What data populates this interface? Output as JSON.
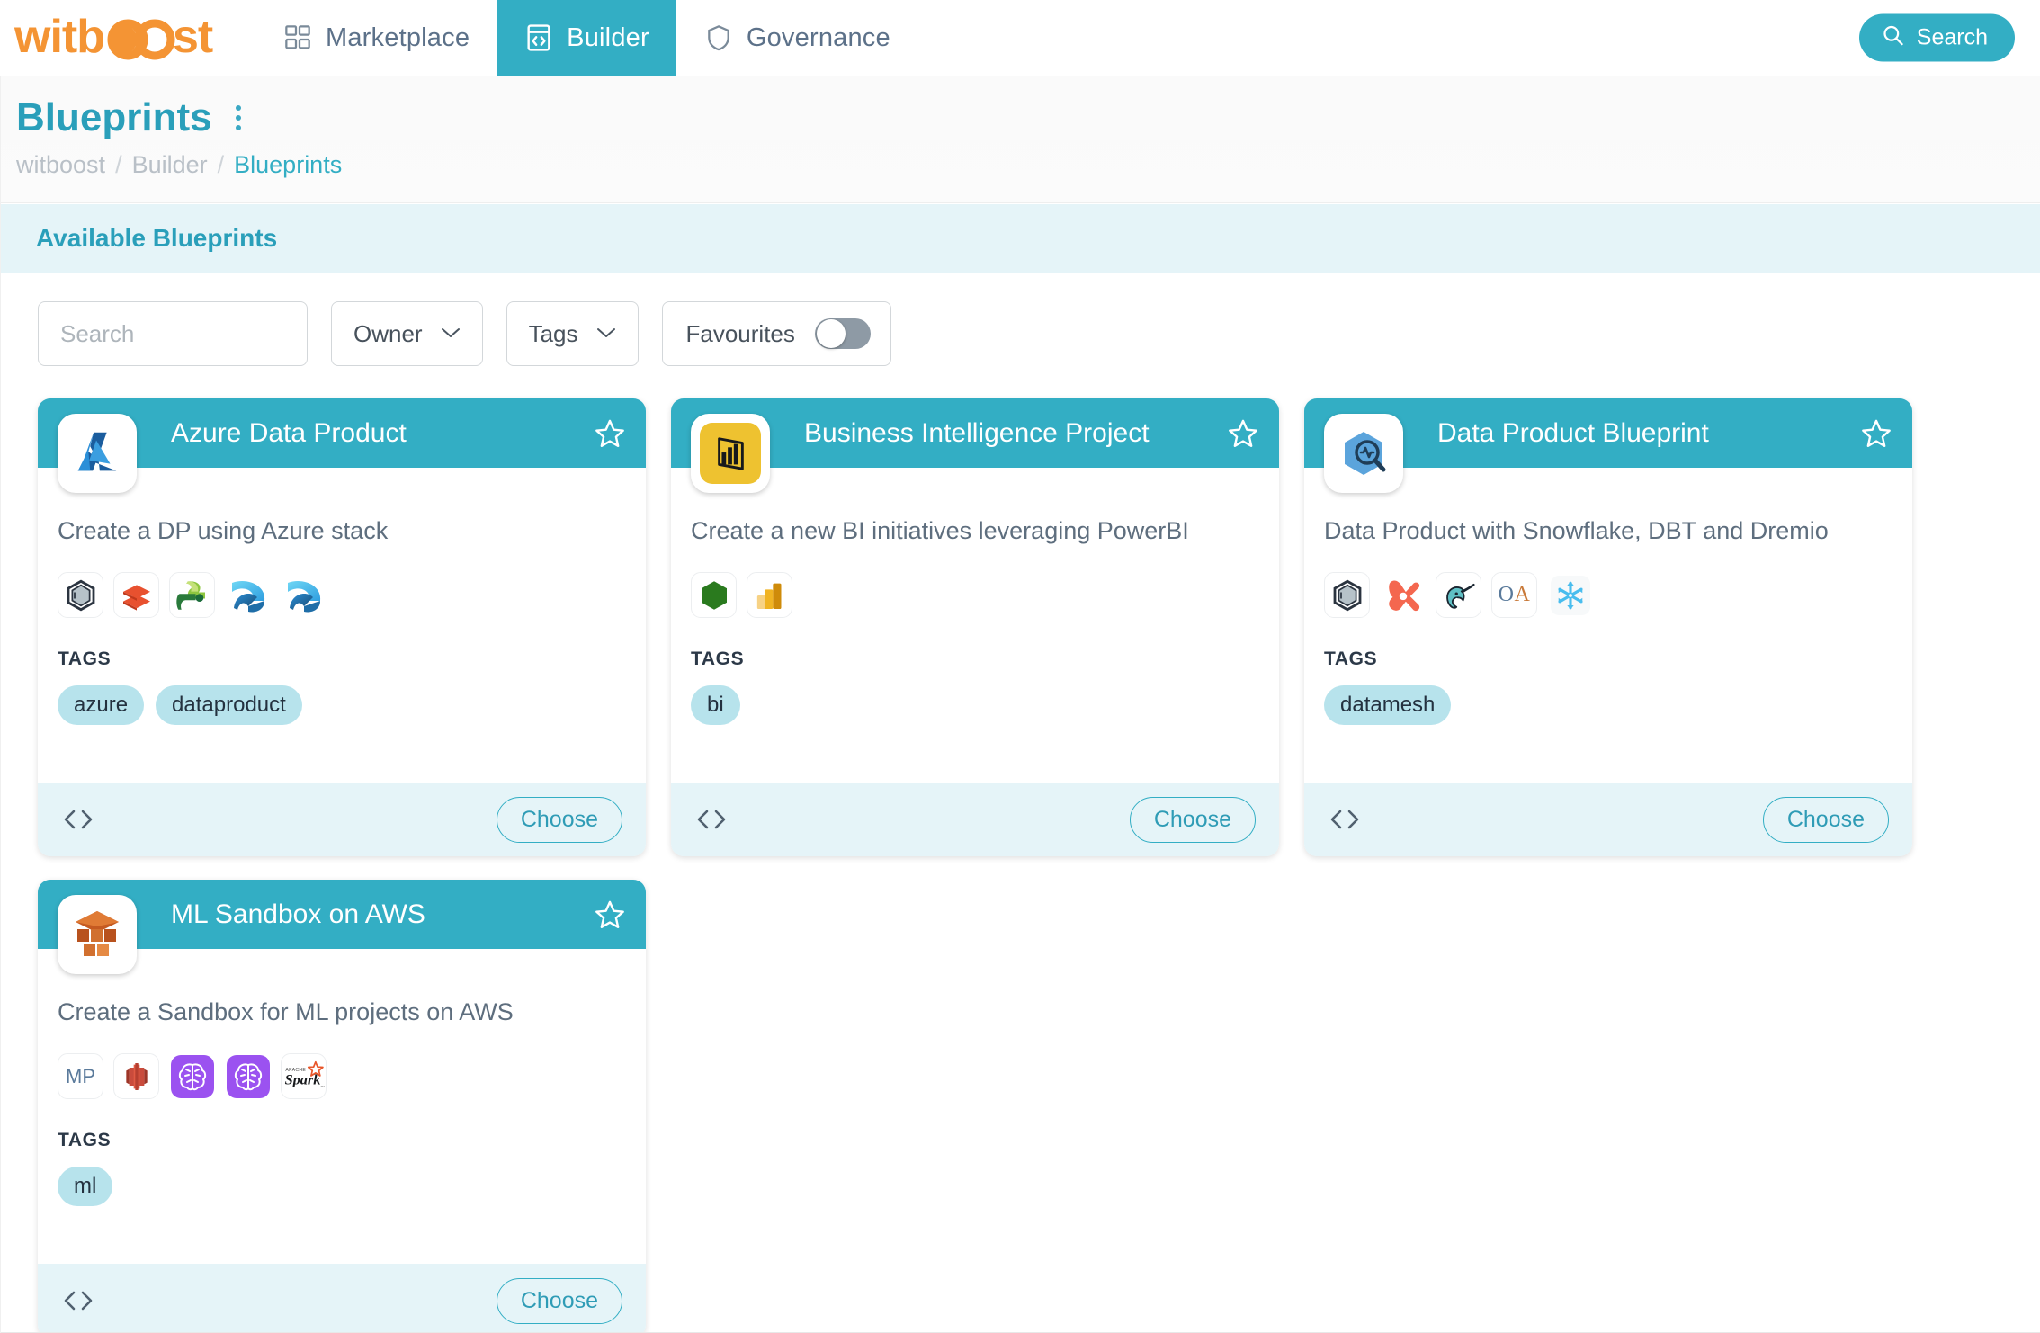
{
  "app": {
    "brand": "witboost",
    "nav": [
      {
        "label": "Marketplace",
        "icon": "grid-icon",
        "active": false
      },
      {
        "label": "Builder",
        "icon": "code-window-icon",
        "active": true
      },
      {
        "label": "Governance",
        "icon": "shield-icon",
        "active": false
      }
    ],
    "search_button": {
      "label": "Search",
      "icon": "search-icon"
    },
    "accent_color": "#33aec4",
    "brand_color": "#f49434"
  },
  "page": {
    "title": "Blueprints",
    "menu_icon": "kebab-menu-icon",
    "breadcrumb": [
      {
        "label": "witboost",
        "current": false
      },
      {
        "label": "Builder",
        "current": false
      },
      {
        "label": "Blueprints",
        "current": true
      }
    ],
    "breadcrumb_separator": "/"
  },
  "section": {
    "label": "Available Blueprints",
    "background": "#e5f4f8"
  },
  "filters": {
    "search": {
      "value": "",
      "placeholder": "Search",
      "icon": "search-icon"
    },
    "owner": {
      "label": "Owner",
      "icon": "chevron-down-icon"
    },
    "tags": {
      "label": "Tags",
      "icon": "chevron-down-icon"
    },
    "favourites": {
      "label": "Favourites",
      "enabled": false
    }
  },
  "cards": [
    {
      "title": "Azure Data Product",
      "description": "Create a DP using Azure stack",
      "logo": "azure-logo",
      "favourite": false,
      "favourite_icon": "star-outline-icon",
      "tech_icons": [
        "witboost-hexagon-icon",
        "databricks-icon",
        "azure-data-factory-icon",
        "azure-synapse-icon",
        "azure-synapse-icon"
      ],
      "tags_label": "TAGS",
      "tags": [
        "azure",
        "dataproduct"
      ],
      "code_icon": "code-brackets-icon",
      "action": "Choose"
    },
    {
      "title": "Business Intelligence Project",
      "description": "Create a new BI initiatives leveraging PowerBI",
      "logo": "powerbi-logo",
      "favourite": false,
      "favourite_icon": "star-outline-icon",
      "tech_icons": [
        "green-hexagon-icon",
        "powerbi-icon"
      ],
      "tags_label": "TAGS",
      "tags": [
        "bi"
      ],
      "code_icon": "code-brackets-icon",
      "action": "Choose"
    },
    {
      "title": "Data Product Blueprint",
      "description": "Data Product with Snowflake, DBT and Dremio",
      "logo": "data-product-hexagon-logo",
      "favourite": false,
      "favourite_icon": "star-outline-icon",
      "tech_icons": [
        "witboost-hexagon-icon",
        "dbt-icon",
        "dremio-narwhal-icon",
        "openapi-oa-icon",
        "snowflake-icon"
      ],
      "tags_label": "TAGS",
      "tags": [
        "datamesh"
      ],
      "code_icon": "code-brackets-icon",
      "action": "Choose"
    },
    {
      "title": "ML Sandbox on AWS",
      "description": "Create a Sandbox for ML projects on AWS",
      "logo": "aws-s3-logo",
      "favourite": false,
      "favourite_icon": "star-outline-icon",
      "tech_icons": [
        "mp-text-icon",
        "aws-redshift-icon",
        "sagemaker-brain-icon",
        "sagemaker-brain-icon",
        "apache-spark-icon"
      ],
      "tags_label": "TAGS",
      "tags": [
        "ml"
      ],
      "code_icon": "code-brackets-icon",
      "action": "Choose"
    }
  ]
}
